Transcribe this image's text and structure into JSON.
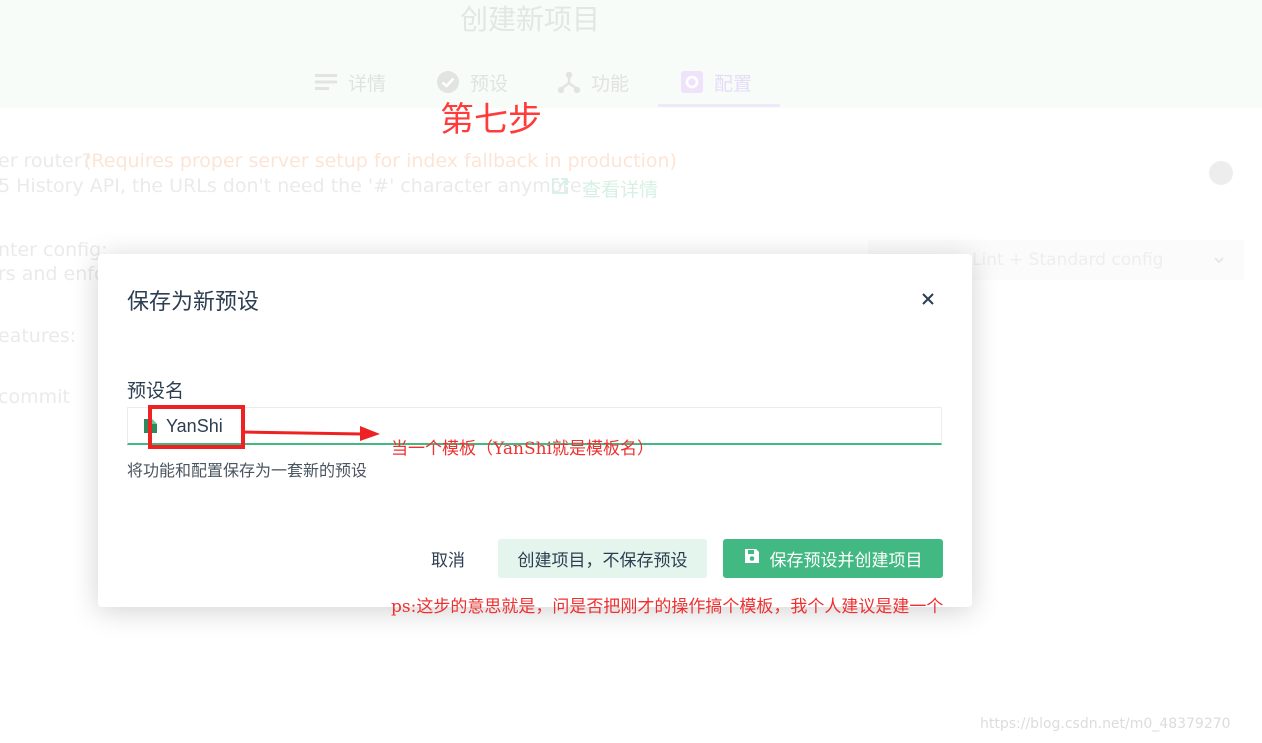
{
  "background": {
    "page_title": "创建新项目",
    "tabs": [
      {
        "label": "详情",
        "icon": "list-icon"
      },
      {
        "label": "预设",
        "icon": "check-circle-icon"
      },
      {
        "label": "功能",
        "icon": "fork-icon"
      },
      {
        "label": "配置",
        "icon": "settings-icon"
      }
    ],
    "active_tab": "配置",
    "router_question": "er router?",
    "router_note": "(Requires proper server setup for index fallback in production)",
    "router_desc": "5 History API, the URLs don't need the '#' character anymore.",
    "more_link": "查看详情",
    "linter_label": "nter config:",
    "linter_desc": "rs and enfo",
    "linter_value": "Lint + Standard config",
    "features_label": "eatures:",
    "commit_label": "commit"
  },
  "dialog": {
    "title": "保存为新预设",
    "field_label": "预设名",
    "field_value": "YanShi",
    "field_desc": "将功能和配置保存为一套新的预设",
    "cancel_label": "取消",
    "create_nosave_label": "创建项目，不保存预设",
    "save_create_label": "保存预设并创建项目"
  },
  "annotations": {
    "step": "第七步",
    "arrow_note": "当一个模板（YanShi就是模板名）",
    "ps_note": "ps:这步的意思就是，问是否把刚才的操作搞个模板，我个人建议是建一个"
  },
  "watermark": "https://blog.csdn.net/m0_48379270",
  "colors": {
    "accent_green": "#42b983",
    "annotation_red": "#ee2222",
    "text_dark": "#2c3e50"
  }
}
